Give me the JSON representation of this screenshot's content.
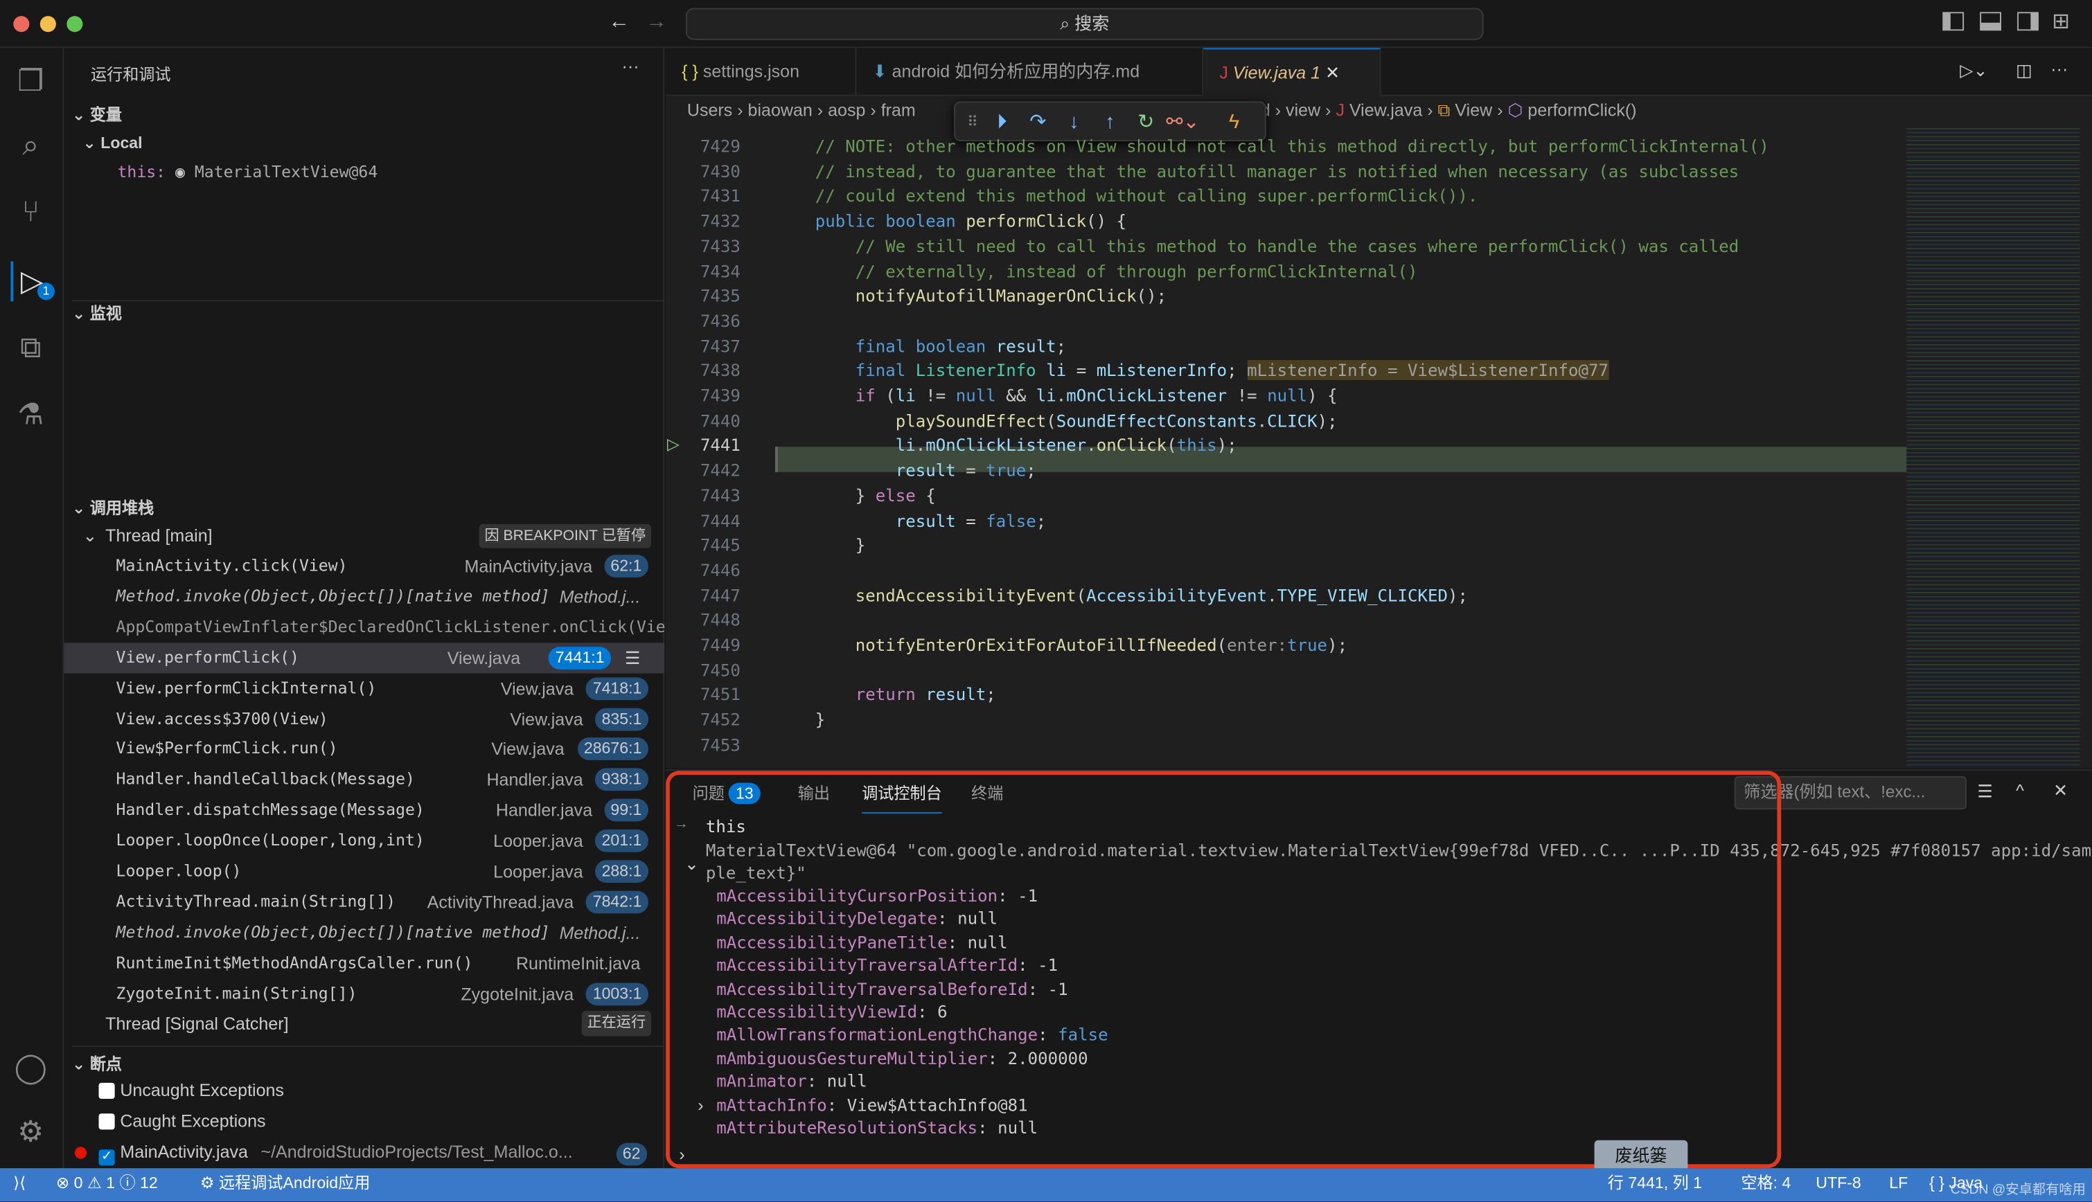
{
  "window": {
    "search_placeholder": "搜索"
  },
  "tabs": [
    {
      "label": "settings.json",
      "icon": "braces-icon"
    },
    {
      "label": "android 如何分析应用的内存.md",
      "icon": "markdown-arrow-icon"
    },
    {
      "label": "View.java",
      "problems": "1",
      "icon": "java-icon",
      "active": true
    }
  ],
  "breadcrumb": {
    "before": [
      "Users",
      "biaowan",
      "aosp",
      "fram"
    ],
    "after": [
      "id",
      "view",
      "View.java",
      "View",
      "performClick()"
    ]
  },
  "sidebar": {
    "title": "运行和调试",
    "variables": {
      "title": "变量",
      "scope": "Local",
      "item_name": "this:",
      "item_value": "MaterialTextView@64"
    },
    "watch": {
      "title": "监视"
    },
    "callstack": {
      "title": "调用堆栈",
      "thread_main": "Thread [main]",
      "paused_label": "因 BREAKPOINT 已暂停",
      "frames": [
        {
          "fn": "MainActivity.click(View)",
          "file": "MainActivity.java",
          "pos": "62:1"
        },
        {
          "fn": "Method.invoke(Object,Object[])[native method]",
          "file": "Method.j...",
          "pos": "",
          "style": "it"
        },
        {
          "fn": "AppCompatViewInflater$DeclaredOnClickListener.onClick(View)",
          "file": "",
          "pos": "",
          "style": "dim"
        },
        {
          "fn": "View.performClick()",
          "file": "View.java",
          "pos": "7441:1",
          "selected": true
        },
        {
          "fn": "View.performClickInternal()",
          "file": "View.java",
          "pos": "7418:1"
        },
        {
          "fn": "View.access$3700(View)",
          "file": "View.java",
          "pos": "835:1"
        },
        {
          "fn": "View$PerformClick.run()",
          "file": "View.java",
          "pos": "28676:1"
        },
        {
          "fn": "Handler.handleCallback(Message)",
          "file": "Handler.java",
          "pos": "938:1"
        },
        {
          "fn": "Handler.dispatchMessage(Message)",
          "file": "Handler.java",
          "pos": "99:1"
        },
        {
          "fn": "Looper.loopOnce(Looper,long,int)",
          "file": "Looper.java",
          "pos": "201:1"
        },
        {
          "fn": "Looper.loop()",
          "file": "Looper.java",
          "pos": "288:1"
        },
        {
          "fn": "ActivityThread.main(String[])",
          "file": "ActivityThread.java",
          "pos": "7842:1"
        },
        {
          "fn": "Method.invoke(Object,Object[])[native method]",
          "file": "Method.j...",
          "pos": "",
          "style": "it"
        },
        {
          "fn": "RuntimeInit$MethodAndArgsCaller.run()",
          "file": "RuntimeInit.java",
          "pos": ""
        },
        {
          "fn": "ZygoteInit.main(String[])",
          "file": "ZygoteInit.java",
          "pos": "1003:1"
        }
      ],
      "thread_signal": "Thread [Signal Catcher]",
      "running_label": "正在运行"
    },
    "breakpoints": {
      "title": "断点",
      "items": [
        {
          "label": "Uncaught Exceptions",
          "checked": false
        },
        {
          "label": "Caught Exceptions",
          "checked": false
        },
        {
          "label": "MainActivity.java",
          "path": "~/AndroidStudioProjects/Test_Malloc.o...",
          "line": "62",
          "checked": true
        }
      ]
    }
  },
  "code": {
    "current_line": "7441",
    "lines": [
      {
        "n": "7429",
        "t": [
          [
            "// NOTE: other methods on View should not call this method directly, but performClickInternal()",
            "cm"
          ]
        ]
      },
      {
        "n": "7430",
        "t": [
          [
            "// instead, to guarantee that the autofill manager is notified when necessary (as subclasses",
            "cm"
          ]
        ]
      },
      {
        "n": "7431",
        "t": [
          [
            "// could extend this method without calling super.performClick()).",
            "cm"
          ]
        ]
      },
      {
        "n": "7432",
        "t": [
          [
            "public boolean ",
            "kw"
          ],
          [
            "performClick",
            "fu"
          ],
          [
            "() {",
            ""
          ]
        ]
      },
      {
        "n": "7433",
        "t": [
          [
            "    // We still need to call this method to handle the cases where performClick() was called",
            "cm"
          ]
        ]
      },
      {
        "n": "7434",
        "t": [
          [
            "    // externally, instead of through performClickInternal()",
            "cm"
          ]
        ]
      },
      {
        "n": "7435",
        "t": [
          [
            "    ",
            ""
          ],
          [
            "notifyAutofillManagerOnClick",
            "fu"
          ],
          [
            "();",
            ""
          ]
        ]
      },
      {
        "n": "7436",
        "t": []
      },
      {
        "n": "7437",
        "t": [
          [
            "    final boolean ",
            "kw"
          ],
          [
            "result",
            "va"
          ],
          [
            ";",
            ""
          ]
        ]
      },
      {
        "n": "7438",
        "t": [
          [
            "    final ",
            "kw"
          ],
          [
            "ListenerInfo ",
            "ty"
          ],
          [
            "li",
            "va"
          ],
          [
            " = ",
            ""
          ],
          [
            "mListenerInfo",
            "va"
          ],
          [
            "; ",
            ""
          ],
          [
            "mListenerInfo = View$ListenerInfo@77",
            "hint"
          ]
        ]
      },
      {
        "n": "7439",
        "t": [
          [
            "    if ",
            "ct"
          ],
          [
            "(",
            ""
          ],
          [
            "li",
            "va"
          ],
          [
            " != ",
            ""
          ],
          [
            "null",
            "kw"
          ],
          [
            " && ",
            ""
          ],
          [
            "li",
            "va"
          ],
          [
            ".",
            ""
          ],
          [
            "mOnClickListener",
            "va"
          ],
          [
            " != ",
            ""
          ],
          [
            "null",
            "kw"
          ],
          [
            ") {",
            ""
          ]
        ]
      },
      {
        "n": "7440",
        "t": [
          [
            "        ",
            ""
          ],
          [
            "playSoundEffect",
            "fu"
          ],
          [
            "(",
            ""
          ],
          [
            "SoundEffectConstants",
            "va"
          ],
          [
            ".",
            ""
          ],
          [
            "CLICK",
            "va"
          ],
          [
            ");",
            ""
          ]
        ]
      },
      {
        "n": "7441",
        "t": [
          [
            "        ",
            ""
          ],
          [
            "li",
            "va"
          ],
          [
            ".",
            ""
          ],
          [
            "mOnClickListener",
            "va"
          ],
          [
            ".",
            ""
          ],
          [
            "onClick",
            "fu"
          ],
          [
            "(",
            ""
          ],
          [
            "this",
            "kw"
          ],
          [
            ");",
            ""
          ]
        ]
      },
      {
        "n": "7442",
        "t": [
          [
            "        ",
            ""
          ],
          [
            "result",
            "va"
          ],
          [
            " = ",
            ""
          ],
          [
            "true",
            "kw"
          ],
          [
            ";",
            ""
          ]
        ]
      },
      {
        "n": "7443",
        "t": [
          [
            "    } ",
            ""
          ],
          [
            "else",
            "ct"
          ],
          [
            " {",
            ""
          ]
        ]
      },
      {
        "n": "7444",
        "t": [
          [
            "        ",
            ""
          ],
          [
            "result",
            "va"
          ],
          [
            " = ",
            ""
          ],
          [
            "false",
            "kw"
          ],
          [
            ";",
            ""
          ]
        ]
      },
      {
        "n": "7445",
        "t": [
          [
            "    }",
            ""
          ]
        ]
      },
      {
        "n": "7446",
        "t": []
      },
      {
        "n": "7447",
        "t": [
          [
            "    ",
            ""
          ],
          [
            "sendAccessibilityEvent",
            "fu"
          ],
          [
            "(",
            ""
          ],
          [
            "AccessibilityEvent",
            "va"
          ],
          [
            ".",
            ""
          ],
          [
            "TYPE_VIEW_CLICKED",
            "va"
          ],
          [
            ");",
            ""
          ]
        ]
      },
      {
        "n": "7448",
        "t": []
      },
      {
        "n": "7449",
        "t": [
          [
            "    ",
            ""
          ],
          [
            "notifyEnterOrExitForAutoFillIfNeeded",
            "fu"
          ],
          [
            "(",
            ""
          ],
          [
            "enter:",
            "hint2"
          ],
          [
            "true",
            "kw"
          ],
          [
            ");",
            ""
          ]
        ]
      },
      {
        "n": "7450",
        "t": []
      },
      {
        "n": "7451",
        "t": [
          [
            "    ",
            ""
          ],
          [
            "return ",
            "ct"
          ],
          [
            "result",
            "va"
          ],
          [
            ";",
            ""
          ]
        ]
      },
      {
        "n": "7452",
        "t": [
          [
            "}",
            ""
          ]
        ]
      },
      {
        "n": "7453",
        "t": []
      }
    ]
  },
  "panel": {
    "tabs": [
      {
        "label": "问题",
        "count": "13"
      },
      {
        "label": "输出"
      },
      {
        "label": "调试控制台",
        "active": true
      },
      {
        "label": "终端"
      }
    ],
    "filter_placeholder": "筛选器(例如 text、!exc...",
    "input_echo": "this",
    "result_line1": "MaterialTextView@64 \"com.google.android.material.textview.MaterialTextView{99ef78d VFED..C.. ...P..ID 435,872-645,925 #7f080157 app:id/sam",
    "result_line2": "ple_text}\"",
    "props": [
      {
        "k": "mAccessibilityCursorPosition",
        "v": "-1",
        "t": "pv"
      },
      {
        "k": "mAccessibilityDelegate",
        "v": "null",
        "t": "pv"
      },
      {
        "k": "mAccessibilityPaneTitle",
        "v": "null",
        "t": "pv"
      },
      {
        "k": "mAccessibilityTraversalAfterId",
        "v": "-1",
        "t": "pv"
      },
      {
        "k": "mAccessibilityTraversalBeforeId",
        "v": "-1",
        "t": "pv"
      },
      {
        "k": "mAccessibilityViewId",
        "v": "6",
        "t": "pv"
      },
      {
        "k": "mAllowTransformationLengthChange",
        "v": "false",
        "t": "pb"
      },
      {
        "k": "mAmbiguousGestureMultiplier",
        "v": "2.000000",
        "t": "pv"
      },
      {
        "k": "mAnimator",
        "v": "null",
        "t": "pv"
      },
      {
        "k": "mAttachInfo",
        "v": "View$AttachInfo@81",
        "t": "pv",
        "expandable": true
      },
      {
        "k": "mAttributeResolutionStacks",
        "v": "null",
        "t": "pv"
      }
    ],
    "tooltip": "废纸篓"
  },
  "status": {
    "errors": "0",
    "warnings": "1",
    "info": "12",
    "remote": "远程调试Android应用",
    "position": "行 7441, 列 1",
    "spaces": "空格: 4",
    "encoding": "UTF-8",
    "eol": "LF",
    "language": "{ } Java",
    "watermark": "CSDN @安卓都有啥用"
  },
  "colors": {
    "accent": "#0078d4",
    "statusbar": "#3a78c9",
    "highlight_box": "#e0391f",
    "current_line": "#3e4a3b"
  }
}
